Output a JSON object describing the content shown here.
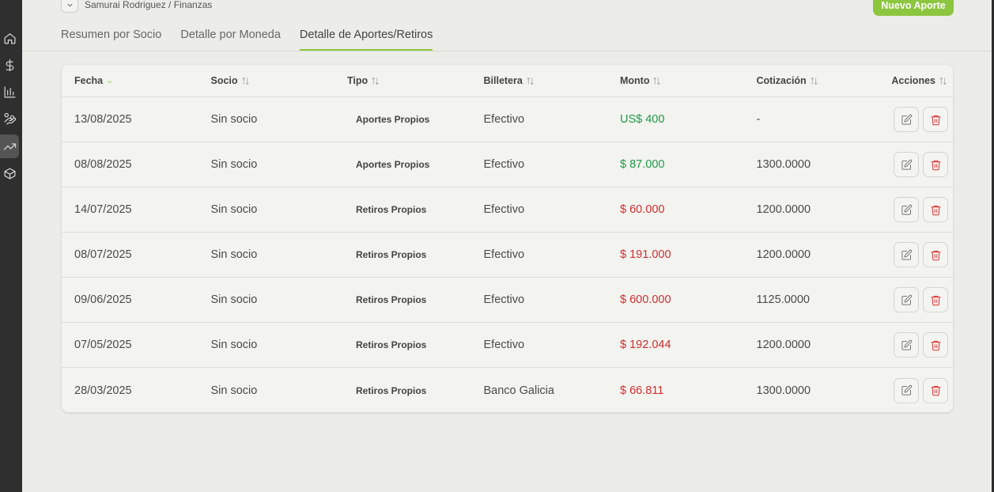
{
  "breadcrumb": {
    "path": "Samurai Rodriguez / Finanzas"
  },
  "header": {
    "new_button": "Nuevo Aporte"
  },
  "tabs": [
    {
      "label": "Resumen por Socio",
      "active": false
    },
    {
      "label": "Detalle por Moneda",
      "active": false
    },
    {
      "label": "Detalle de Aportes/Retiros",
      "active": true
    }
  ],
  "sidebar": {
    "icons": [
      "home-icon",
      "dollar-icon",
      "bar-chart-icon",
      "hand-coins-icon",
      "trending-up-icon",
      "box-icon"
    ],
    "active": "trending-up-icon"
  },
  "table": {
    "headers": {
      "fecha": "Fecha",
      "socio": "Socio",
      "tipo": "Tipo",
      "billetera": "Billetera",
      "monto": "Monto",
      "cotizacion": "Cotización",
      "acciones": "Acciones"
    },
    "rows": [
      {
        "fecha": "13/08/2025",
        "socio": "Sin socio",
        "tipo": "Aportes Propios",
        "billetera": "Efectivo",
        "monto": "US$ 400",
        "monto_kind": "pos",
        "cotizacion": "-"
      },
      {
        "fecha": "08/08/2025",
        "socio": "Sin socio",
        "tipo": "Aportes Propios",
        "billetera": "Efectivo",
        "monto": "$ 87.000",
        "monto_kind": "pos",
        "cotizacion": "1300.0000"
      },
      {
        "fecha": "14/07/2025",
        "socio": "Sin socio",
        "tipo": "Retiros Propios",
        "billetera": "Efectivo",
        "monto": "$ 60.000",
        "monto_kind": "neg",
        "cotizacion": "1200.0000"
      },
      {
        "fecha": "08/07/2025",
        "socio": "Sin socio",
        "tipo": "Retiros Propios",
        "billetera": "Efectivo",
        "monto": "$ 191.000",
        "monto_kind": "neg",
        "cotizacion": "1200.0000"
      },
      {
        "fecha": "09/06/2025",
        "socio": "Sin socio",
        "tipo": "Retiros Propios",
        "billetera": "Efectivo",
        "monto": "$ 600.000",
        "monto_kind": "neg",
        "cotizacion": "1125.0000"
      },
      {
        "fecha": "07/05/2025",
        "socio": "Sin socio",
        "tipo": "Retiros Propios",
        "billetera": "Efectivo",
        "monto": "$ 192.044",
        "monto_kind": "neg",
        "cotizacion": "1200.0000"
      },
      {
        "fecha": "28/03/2025",
        "socio": "Sin socio",
        "tipo": "Retiros Propios",
        "billetera": "Banco Galicia",
        "monto": "$ 66.811",
        "monto_kind": "neg",
        "cotizacion": "1300.0000"
      }
    ]
  },
  "colors": {
    "accent": "#8cc63f",
    "positive": "#1e9a48",
    "negative": "#d12d2d"
  }
}
